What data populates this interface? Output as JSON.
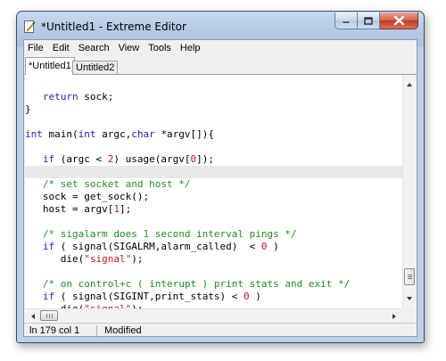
{
  "window": {
    "title": "*Untitled1 - Extreme Editor"
  },
  "menu": [
    "File",
    "Edit",
    "Search",
    "View",
    "Tools",
    "Help"
  ],
  "tabs": [
    {
      "label": "*Untitled1",
      "active": true
    },
    {
      "label": "Untitled2",
      "active": false
    }
  ],
  "editor": {
    "current_line_index": 7,
    "lines": [
      [],
      [
        {
          "t": "   "
        },
        {
          "t": "return",
          "c": "keyword"
        },
        {
          "t": " sock;"
        }
      ],
      [
        {
          "t": "}"
        }
      ],
      [],
      [
        {
          "t": "int",
          "c": "keyword"
        },
        {
          "t": " main("
        },
        {
          "t": "int",
          "c": "keyword"
        },
        {
          "t": " argc,"
        },
        {
          "t": "char",
          "c": "keyword"
        },
        {
          "t": " *argv[]){"
        }
      ],
      [],
      [
        {
          "t": "   "
        },
        {
          "t": "if",
          "c": "keyword"
        },
        {
          "t": " (argc < "
        },
        {
          "t": "2",
          "c": "number"
        },
        {
          "t": ") usage(argv["
        },
        {
          "t": "0",
          "c": "number"
        },
        {
          "t": "]);"
        }
      ],
      [],
      [
        {
          "t": "   "
        },
        {
          "t": "/* set socket and host */",
          "c": "comment"
        }
      ],
      [
        {
          "t": "   sock = get_sock();"
        }
      ],
      [
        {
          "t": "   host = argv["
        },
        {
          "t": "1",
          "c": "number"
        },
        {
          "t": "];"
        }
      ],
      [],
      [
        {
          "t": "   "
        },
        {
          "t": "/* sigalarm does 1 second interval pings */",
          "c": "comment"
        }
      ],
      [
        {
          "t": "   "
        },
        {
          "t": "if",
          "c": "keyword"
        },
        {
          "t": " ( signal(SIGALRM,alarm_called)  < "
        },
        {
          "t": "0",
          "c": "number"
        },
        {
          "t": " )"
        }
      ],
      [
        {
          "t": "      die("
        },
        {
          "t": "\"signal\"",
          "c": "string"
        },
        {
          "t": ");"
        }
      ],
      [],
      [
        {
          "t": "   "
        },
        {
          "t": "/* on control+c ( interupt ) print stats and exit */",
          "c": "comment"
        }
      ],
      [
        {
          "t": "   "
        },
        {
          "t": "if",
          "c": "keyword"
        },
        {
          "t": " ( signal(SIGINT,print_stats) < "
        },
        {
          "t": "0",
          "c": "number"
        },
        {
          "t": " )"
        }
      ],
      [
        {
          "t": "      die("
        },
        {
          "t": "\"signal\"",
          "c": "string"
        },
        {
          "t": ");"
        }
      ]
    ]
  },
  "status": {
    "position": "ln 179 col 1",
    "state": "Modified"
  },
  "colors": {
    "keyword": "#1f1fb5",
    "comment": "#228b22",
    "string": "#c21a1a",
    "current_line": "#e8e8e8"
  },
  "icons": [
    "document-edit-icon",
    "minimize-icon",
    "maximize-icon",
    "close-icon",
    "scroll-up-icon",
    "scroll-down-icon",
    "scroll-left-icon",
    "scroll-right-icon"
  ]
}
